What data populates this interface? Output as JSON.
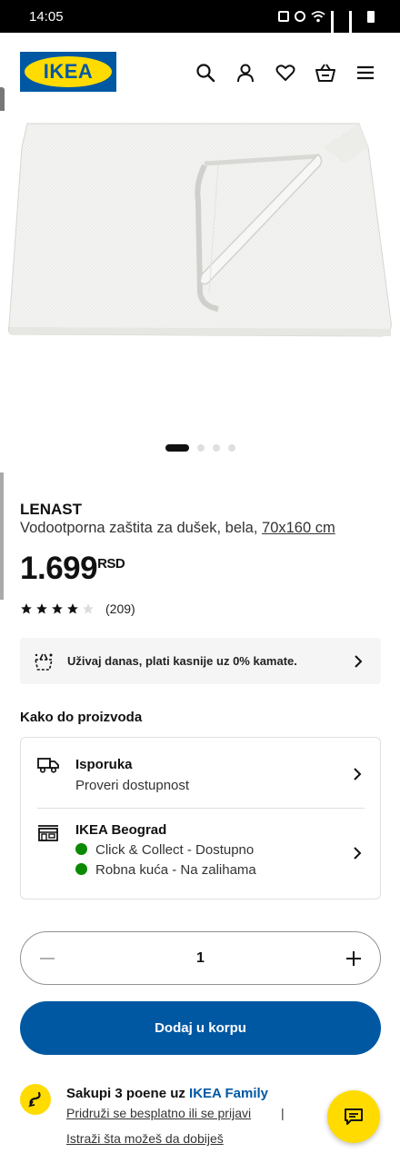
{
  "status_bar": {
    "time": "14:05"
  },
  "header": {
    "logo_text": "IKEA",
    "icons": [
      "search-icon",
      "account-icon",
      "heart-icon",
      "basket-icon",
      "menu-icon"
    ]
  },
  "product": {
    "name": "LENAST",
    "description": "Vodootporna zaštita za dušek, bela,",
    "size": "70x160 cm",
    "price": "1.699",
    "currency": "RSD",
    "rating": 4,
    "reviews": "(209)",
    "image_count": 4,
    "active_image": 1
  },
  "promo": {
    "text": "Uživaj danas, plati kasnije uz 0% kamate."
  },
  "availability": {
    "title": "Kako do proizvoda",
    "delivery": {
      "title": "Isporuka",
      "subtitle": "Proveri dostupnost"
    },
    "store": {
      "title": "IKEA Beograd",
      "status1": "Click & Collect - Dostupno",
      "status2": "Robna kuća - Na zalihama"
    }
  },
  "quantity": {
    "value": "1"
  },
  "add_to_cart": {
    "label": "Dodaj u korpu"
  },
  "family": {
    "title": "Sakupi 3 poene uz ",
    "brand": "IKEA Family",
    "link1": "Pridruži se besplatno ili se prijavi",
    "separator": "|",
    "link2": "Istraži šta možeš da dobiješ"
  },
  "colors": {
    "brand_blue": "#0058a3",
    "brand_yellow": "#ffdb00",
    "status_green": "#0a8a00"
  }
}
